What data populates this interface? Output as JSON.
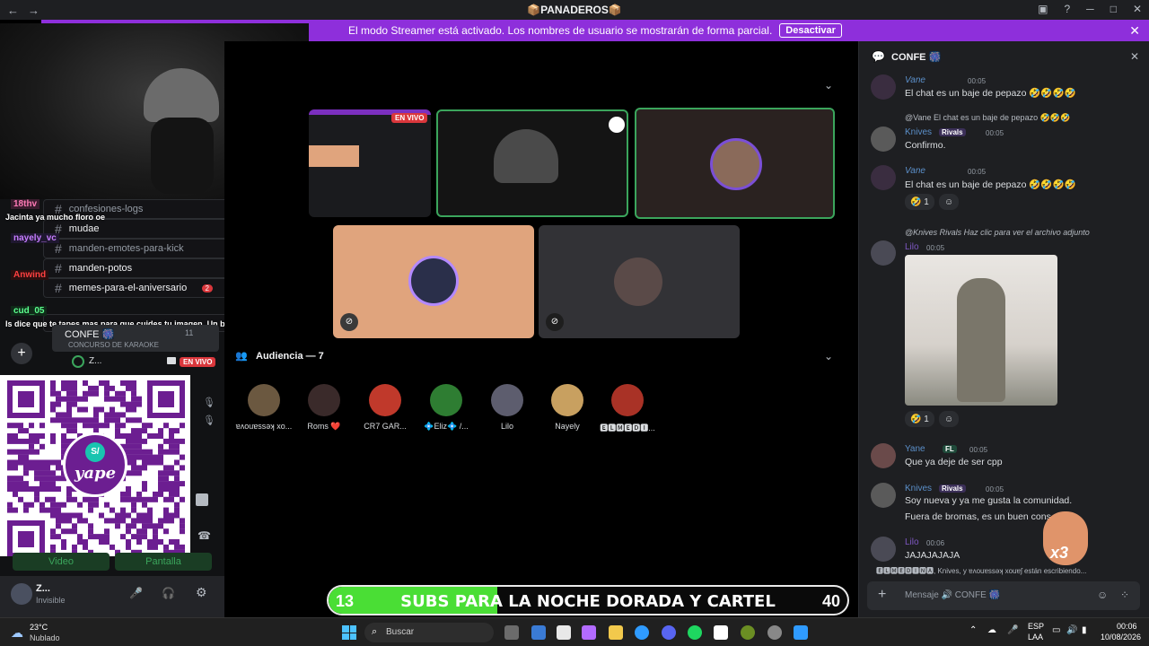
{
  "titlebar": {
    "title": "📦PANADEROS📦",
    "back": "←",
    "forward": "→"
  },
  "banner": {
    "text": "El modo Streamer está activado. Los nombres de usuario se mostrarán de forma parcial.",
    "button": "Desactivar"
  },
  "channels": [
    {
      "name": "confesiones-logs",
      "badge": ""
    },
    {
      "name": "mudae",
      "badge": ""
    },
    {
      "name": "manden-emotes-para-kick",
      "badge": ""
    },
    {
      "name": "manden-potos",
      "badge": ""
    },
    {
      "name": "memes-para-el-aniversario",
      "badge": "2"
    }
  ],
  "overlay_chat": [
    {
      "user": "18thv",
      "color": "#ff7ab6",
      "text": "Jacinta ya mucho floro oe"
    },
    {
      "user": "nayely_vc",
      "color": "#c77dff",
      "text": ""
    },
    {
      "user": "Anwind",
      "color": "#ff4040",
      "text": ""
    },
    {
      "user": "cud_05",
      "color": "#5cff8f",
      "text": "Is dice que te tapes mas para que cuides tu imagen. Un bozal mas grande"
    }
  ],
  "voice": {
    "channel_name": "CONFE 🎆",
    "listeners": "11",
    "topic": "CONCURSO DE KARAOKE",
    "user": "Z...",
    "live": "EN VIVO"
  },
  "qr": {
    "brand": "yape",
    "logo": "S/"
  },
  "buttons": {
    "video": "Video",
    "screen": "Pantalla"
  },
  "user_panel": {
    "name": "Z...",
    "status": "Invisible"
  },
  "stage": {
    "live_badge": "EN VIVO",
    "audience_label": "Audiencia — 7",
    "audience": [
      {
        "name": "ɐʌouɐssǝʞ xo...",
        "color": "#6b5840"
      },
      {
        "name": "Roms ❤️",
        "color": "#3a2a2a"
      },
      {
        "name": "CR7 GAR...",
        "color": "#c0392b"
      },
      {
        "name": "💠Eliz💠 /...",
        "color": "#2e7d32"
      },
      {
        "name": "Lilo",
        "color": "#5d5d6e"
      },
      {
        "name": "Nayely",
        "color": "#c8a060"
      },
      {
        "name": "🅴🅻🅼🅴🅳🅸...",
        "color": "#a93226"
      }
    ]
  },
  "subs_bar": {
    "text": "SUBS PARA LA NOCHE DORADA Y CARTEL",
    "current": "13",
    "goal": "40",
    "progress": 0.325
  },
  "chat": {
    "channel": "CONFE 🎆",
    "messages": [
      {
        "user": "Vane",
        "color": "#5b8fc9",
        "time": "00:05",
        "text": "El chat es un baje de pepazo 🤣🤣🤣🤣"
      },
      {
        "reply_to": "@Vane  El chat es un baje de pepazo 🤣🤣🤣",
        "user": "Knives",
        "tag": "Rivals",
        "color": "#5b8fc9",
        "time": "00:05",
        "text": "Confirmo."
      },
      {
        "user": "Vane",
        "color": "#5b8fc9",
        "time": "00:05",
        "text": "El chat es un baje de pepazo 🤣🤣🤣🤣",
        "reaction": "🤣 1"
      },
      {
        "reply_to": "@Knives  Rivals  Haz clic para ver el archivo adjunto",
        "user": "Lilo",
        "color": "#7e57c2",
        "time": "00:05",
        "text": "",
        "reaction": "🤣 1"
      },
      {
        "user": "Yane",
        "tag": "FL",
        "color": "#5b8fc9",
        "time": "00:05",
        "text": "Que ya deje de ser cpp"
      },
      {
        "user": "Knives",
        "tag": "Rivals",
        "color": "#5b8fc9",
        "time": "00:05",
        "text": "Soy nueva y ya me gusta la comunidad.",
        "text2": "Fuera de bromas, es un buen cons"
      },
      {
        "user": "Lilo",
        "color": "#7e57c2",
        "time": "00:06",
        "text": "JAJAJAJAJA"
      }
    ],
    "typing": "🅴🅻🅼🅴🅳🅸🅽🅰, Knives, y ɐʌouɐssǝʞ xouɐʃ están escribiendo...",
    "placeholder": "Mensaje 🔊 CONFE 🎆",
    "sticker_label": "x3"
  },
  "taskbar": {
    "weather_temp": "23°C",
    "weather_desc": "Nublado",
    "search": "Buscar",
    "lang1": "ESP",
    "lang2": "LAA",
    "time": "00:06",
    "date": "10/08/2026"
  }
}
